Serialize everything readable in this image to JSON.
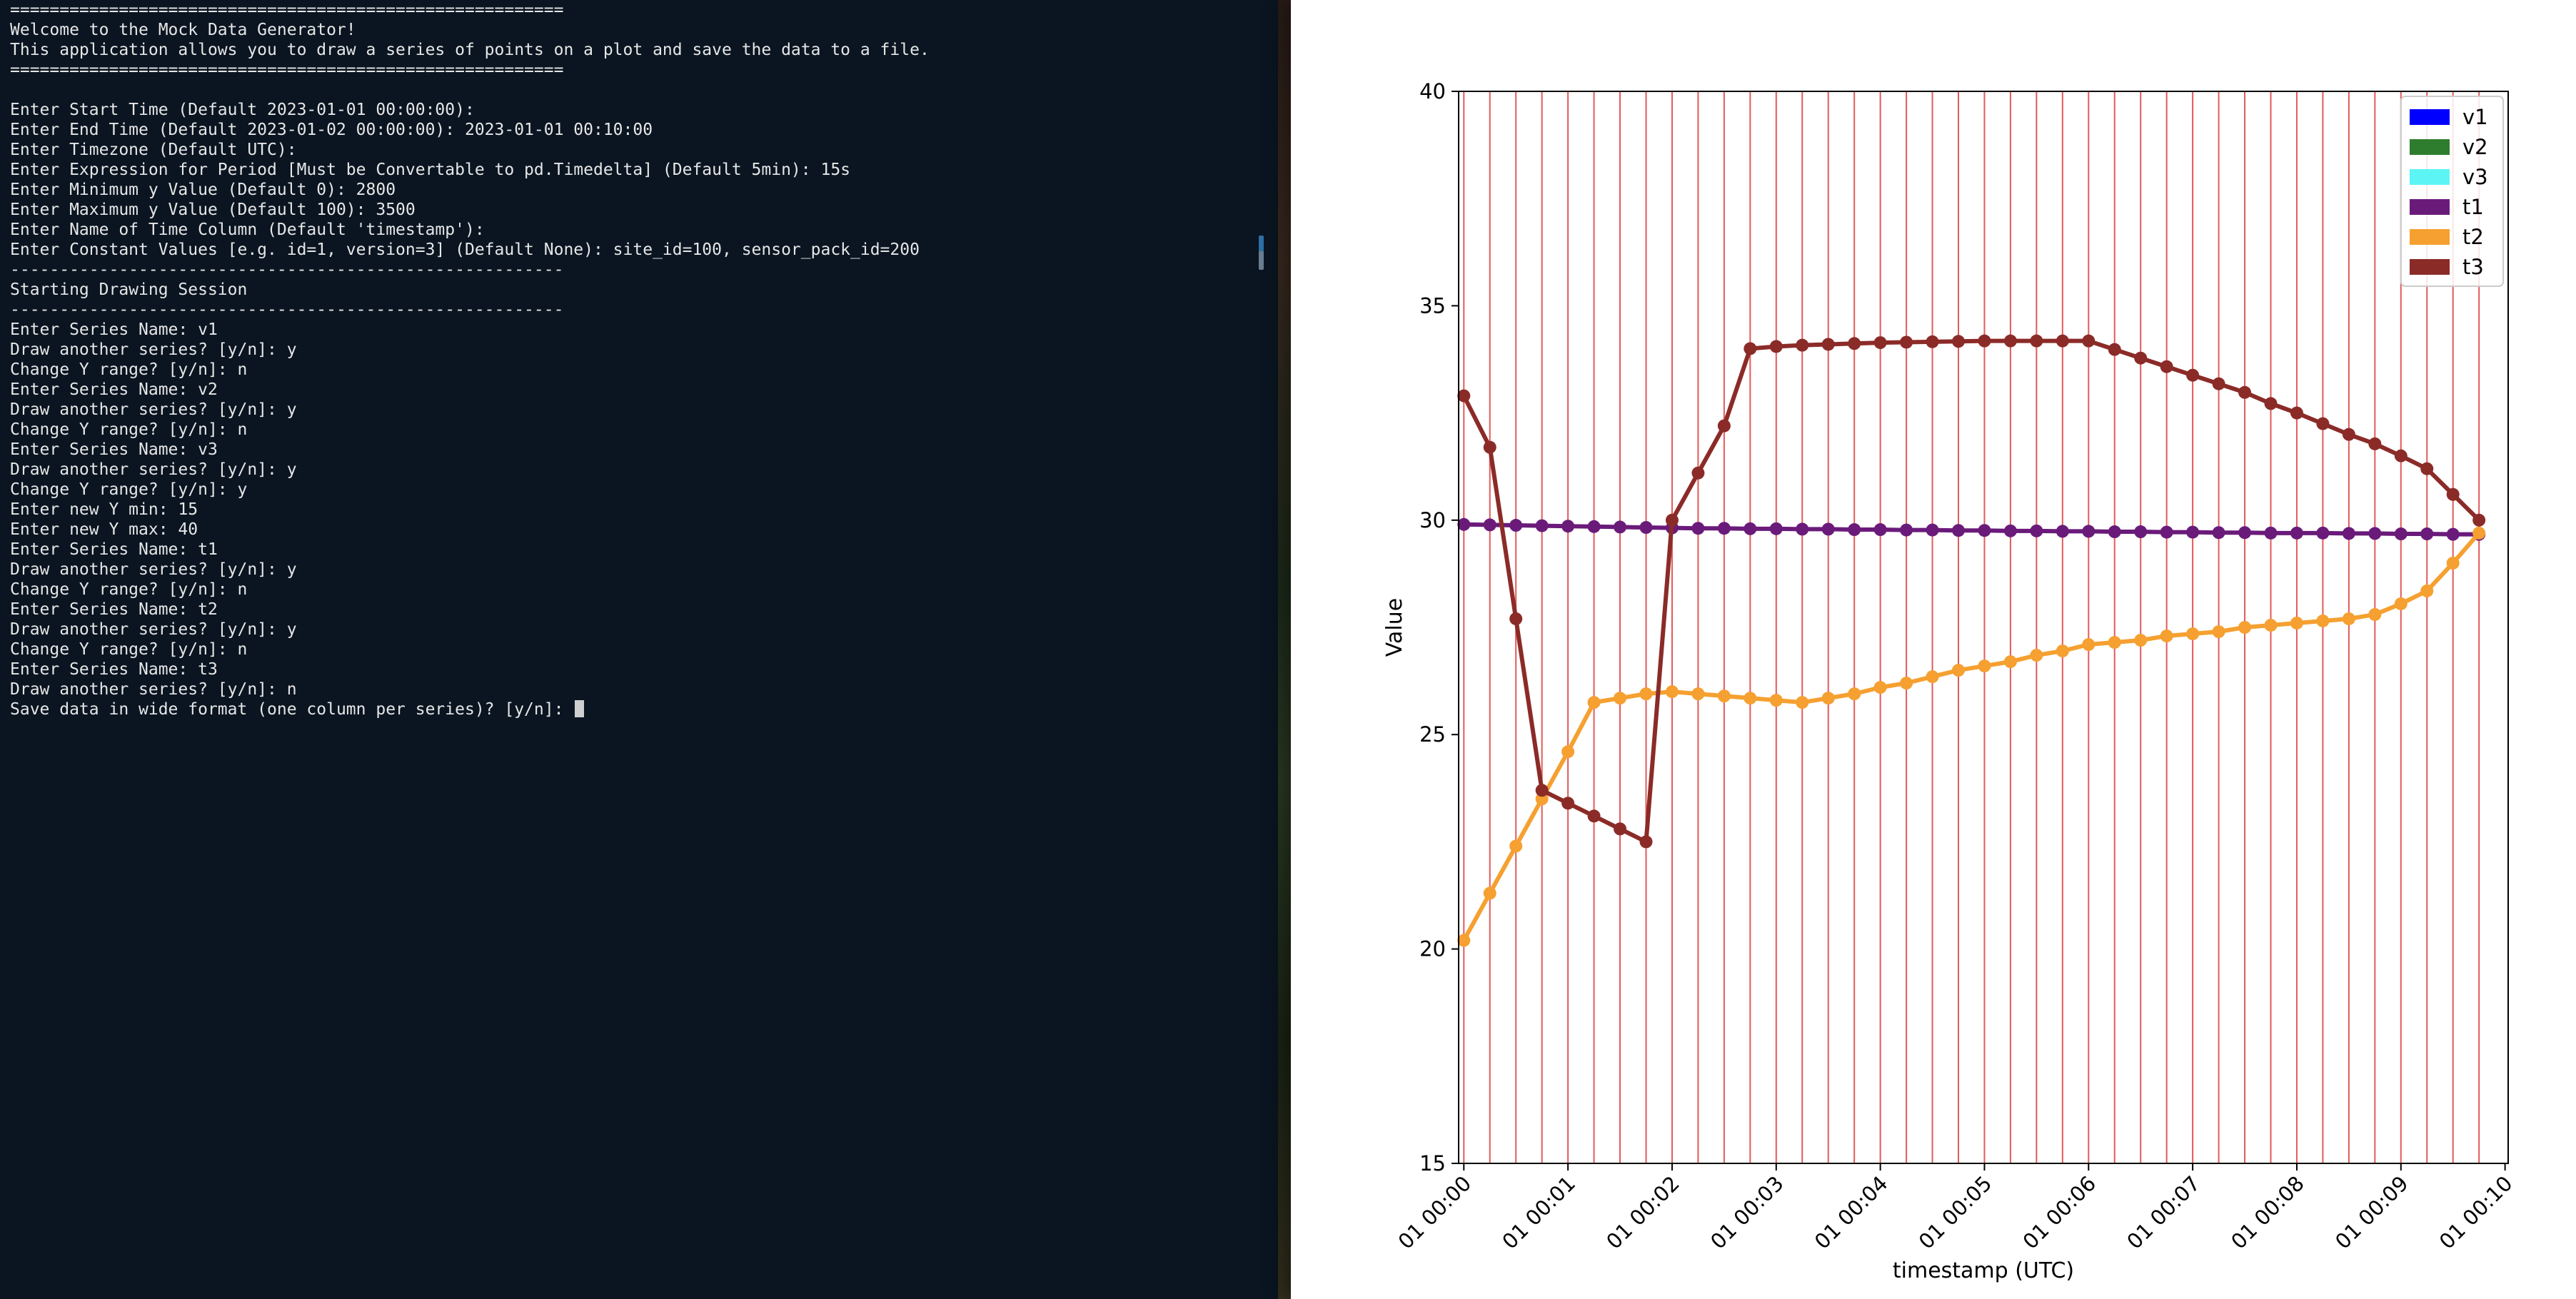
{
  "terminal": {
    "lines": [
      "========================================================",
      "Welcome to the Mock Data Generator!",
      "This application allows you to draw a series of points on a plot and save the data to a file.",
      "========================================================",
      "",
      "Enter Start Time (Default 2023-01-01 00:00:00):",
      "Enter End Time (Default 2023-01-02 00:00:00): 2023-01-01 00:10:00",
      "Enter Timezone (Default UTC):",
      "Enter Expression for Period [Must be Convertable to pd.Timedelta] (Default 5min): 15s",
      "Enter Minimum y Value (Default 0): 2800",
      "Enter Maximum y Value (Default 100): 3500",
      "Enter Name of Time Column (Default 'timestamp'):",
      "Enter Constant Values [e.g. id=1, version=3] (Default None): site_id=100, sensor_pack_id=200",
      "--------------------------------------------------------",
      "Starting Drawing Session",
      "--------------------------------------------------------",
      "Enter Series Name: v1",
      "Draw another series? [y/n]: y",
      "Change Y range? [y/n]: n",
      "Enter Series Name: v2",
      "Draw another series? [y/n]: y",
      "Change Y range? [y/n]: n",
      "Enter Series Name: v3",
      "Draw another series? [y/n]: y",
      "Change Y range? [y/n]: y",
      "Enter new Y min: 15",
      "Enter new Y max: 40",
      "Enter Series Name: t1",
      "Draw another series? [y/n]: y",
      "Change Y range? [y/n]: n",
      "Enter Series Name: t2",
      "Draw another series? [y/n]: y",
      "Change Y range? [y/n]: n",
      "Enter Series Name: t3",
      "Draw another series? [y/n]: n",
      "Save data in wide format (one column per series)? [y/n]: "
    ]
  },
  "chart_data": {
    "type": "line",
    "xlabel": "timestamp (UTC)",
    "ylabel": "Value",
    "ylim": [
      15,
      40
    ],
    "xlim_minutes": [
      -0.05,
      10.03
    ],
    "yticks": [
      15,
      20,
      25,
      30,
      35,
      40
    ],
    "xticks": [
      {
        "minute": 0,
        "label": "01 00:00"
      },
      {
        "minute": 1,
        "label": "01 00:01"
      },
      {
        "minute": 2,
        "label": "01 00:02"
      },
      {
        "minute": 3,
        "label": "01 00:03"
      },
      {
        "minute": 4,
        "label": "01 00:04"
      },
      {
        "minute": 5,
        "label": "01 00:05"
      },
      {
        "minute": 6,
        "label": "01 00:06"
      },
      {
        "minute": 7,
        "label": "01 00:07"
      },
      {
        "minute": 8,
        "label": "01 00:08"
      },
      {
        "minute": 9,
        "label": "01 00:09"
      },
      {
        "minute": 10,
        "label": "01 00:10"
      }
    ],
    "vline_minutes": [
      0,
      0.25,
      0.5,
      0.75,
      1,
      1.25,
      1.5,
      1.75,
      2,
      2.25,
      2.5,
      2.75,
      3,
      3.25,
      3.5,
      3.75,
      4,
      4.25,
      4.5,
      4.75,
      5,
      5.25,
      5.5,
      5.75,
      6,
      6.25,
      6.5,
      6.75,
      7,
      7.25,
      7.5,
      7.75,
      8,
      8.25,
      8.5,
      8.75,
      9,
      9.25,
      9.5,
      9.75
    ],
    "vline_color": "#e35a5a",
    "legend_position": "top-right",
    "series": [
      {
        "name": "v1",
        "color": "#0000ff",
        "x_minutes": [],
        "y": []
      },
      {
        "name": "v2",
        "color": "#2e7d2e",
        "x_minutes": [],
        "y": []
      },
      {
        "name": "v3",
        "color": "#5cf4f4",
        "x_minutes": [],
        "y": []
      },
      {
        "name": "t1",
        "color": "#6a1b7a",
        "x_minutes": [
          0,
          0.25,
          0.5,
          0.75,
          1,
          1.25,
          1.5,
          1.75,
          2,
          2.25,
          2.5,
          2.75,
          3,
          3.25,
          3.5,
          3.75,
          4,
          4.25,
          4.5,
          4.75,
          5,
          5.25,
          5.5,
          5.75,
          6,
          6.25,
          6.5,
          6.75,
          7,
          7.25,
          7.5,
          7.75,
          8,
          8.25,
          8.5,
          8.75,
          9,
          9.25,
          9.5,
          9.75
        ],
        "y": [
          29.9,
          29.89,
          29.88,
          29.87,
          29.86,
          29.85,
          29.84,
          29.83,
          29.82,
          29.81,
          29.81,
          29.8,
          29.8,
          29.79,
          29.79,
          29.78,
          29.78,
          29.77,
          29.77,
          29.76,
          29.76,
          29.75,
          29.75,
          29.74,
          29.74,
          29.73,
          29.73,
          29.72,
          29.72,
          29.71,
          29.71,
          29.7,
          29.7,
          29.7,
          29.69,
          29.69,
          29.68,
          29.68,
          29.67,
          29.67
        ]
      },
      {
        "name": "t2",
        "color": "#f5a030",
        "x_minutes": [
          0,
          0.25,
          0.5,
          0.75,
          1,
          1.25,
          1.5,
          1.75,
          2,
          2.25,
          2.5,
          2.75,
          3,
          3.25,
          3.5,
          3.75,
          4,
          4.25,
          4.5,
          4.75,
          5,
          5.25,
          5.5,
          5.75,
          6,
          6.25,
          6.5,
          6.75,
          7,
          7.25,
          7.5,
          7.75,
          8,
          8.25,
          8.5,
          8.75,
          9,
          9.25,
          9.5,
          9.75
        ],
        "y": [
          20.2,
          21.3,
          22.4,
          23.5,
          24.6,
          25.75,
          25.85,
          25.95,
          26.0,
          25.95,
          25.9,
          25.85,
          25.8,
          25.75,
          25.85,
          25.95,
          26.1,
          26.2,
          26.35,
          26.5,
          26.6,
          26.7,
          26.85,
          26.95,
          27.1,
          27.15,
          27.2,
          27.3,
          27.35,
          27.4,
          27.5,
          27.55,
          27.6,
          27.65,
          27.7,
          27.8,
          28.05,
          28.35,
          29.0,
          29.7
        ]
      },
      {
        "name": "t3",
        "color": "#8b2b28",
        "x_minutes": [
          0,
          0.25,
          0.5,
          0.75,
          1,
          1.25,
          1.5,
          1.75,
          2,
          2.25,
          2.5,
          2.75,
          3,
          3.25,
          3.5,
          3.75,
          4,
          4.25,
          4.5,
          4.75,
          5,
          5.25,
          5.5,
          5.75,
          6,
          6.25,
          6.5,
          6.75,
          7,
          7.25,
          7.5,
          7.75,
          8,
          8.25,
          8.5,
          8.75,
          9,
          9.25,
          9.5,
          9.75
        ],
        "y": [
          32.9,
          31.7,
          27.7,
          23.7,
          23.4,
          23.1,
          22.8,
          22.5,
          30.0,
          31.1,
          32.2,
          34.0,
          34.05,
          34.08,
          34.1,
          34.12,
          34.14,
          34.15,
          34.16,
          34.17,
          34.18,
          34.18,
          34.18,
          34.18,
          34.18,
          33.98,
          33.78,
          33.58,
          33.38,
          33.18,
          32.98,
          32.72,
          32.5,
          32.25,
          32.0,
          31.78,
          31.5,
          31.2,
          30.6,
          30.0
        ]
      }
    ]
  }
}
